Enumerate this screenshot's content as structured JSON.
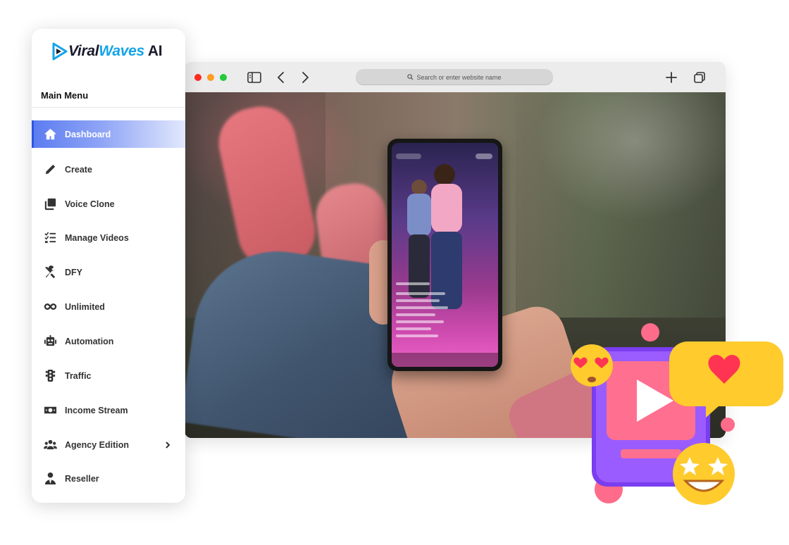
{
  "brand": {
    "logo_viral": "Viral",
    "logo_waves": "Waves",
    "logo_ai": "AI"
  },
  "sidebar": {
    "title": "Main Menu",
    "items": [
      {
        "label": "Dashboard",
        "icon": "home-icon",
        "active": true
      },
      {
        "label": "Create",
        "icon": "pencil-icon"
      },
      {
        "label": "Voice Clone",
        "icon": "copy-icon"
      },
      {
        "label": "Manage Videos",
        "icon": "tasks-list-icon"
      },
      {
        "label": "DFY",
        "icon": "tools-icon"
      },
      {
        "label": "Unlimited",
        "icon": "infinity-icon"
      },
      {
        "label": "Automation",
        "icon": "robot-icon"
      },
      {
        "label": "Traffic",
        "icon": "traffic-light-icon"
      },
      {
        "label": "Income Stream",
        "icon": "money-bill-icon"
      },
      {
        "label": "Agency Edition",
        "icon": "users-icon",
        "has_submenu": true
      },
      {
        "label": "Reseller",
        "icon": "user-tie-icon"
      }
    ]
  },
  "browser": {
    "address_placeholder": "Search or enter website name"
  },
  "colors": {
    "accent": "#2b56e4",
    "logo_blue": "#12a4e8",
    "traffic_red": "#ff2d20",
    "traffic_orange": "#ff9b1f",
    "traffic_green": "#25c93a"
  }
}
